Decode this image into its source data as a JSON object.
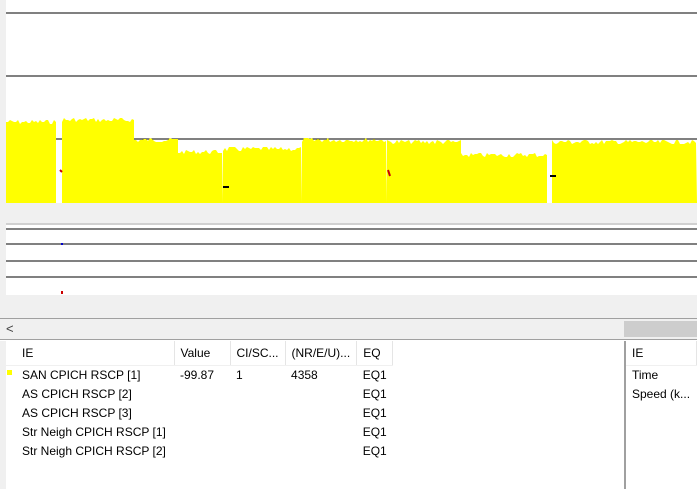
{
  "colors": {
    "signal_fill": "#ffff00",
    "panel_bg": "#ffffff",
    "frame": "#f0f0f0",
    "event_red": "#cc0000",
    "event_black": "#000000",
    "event_blue": "#0000cc"
  },
  "scrollbar": {
    "left_arrow": "<"
  },
  "ie_table": {
    "headers": [
      "IE",
      "Value",
      "CI/SC...",
      "(NR/E/U)...",
      "EQ"
    ],
    "rows": [
      {
        "ie": "SAN CPICH RSCP [1]",
        "value": "-99.87",
        "ci": "1",
        "nr": "4358",
        "eq": "EQ1",
        "marker_color": "#ffff00"
      },
      {
        "ie": "AS CPICH RSCP [2]",
        "value": "",
        "ci": "",
        "nr": "",
        "eq": "EQ1",
        "marker_color": ""
      },
      {
        "ie": "AS CPICH RSCP [3]",
        "value": "",
        "ci": "",
        "nr": "",
        "eq": "EQ1",
        "marker_color": ""
      },
      {
        "ie": "Str Neigh CPICH RSCP [1]",
        "value": "",
        "ci": "",
        "nr": "",
        "eq": "EQ1",
        "marker_color": ""
      },
      {
        "ie": "Str Neigh CPICH RSCP [2]",
        "value": "",
        "ci": "",
        "nr": "",
        "eq": "EQ1",
        "marker_color": ""
      }
    ]
  },
  "right_table": {
    "header": "IE",
    "rows": [
      "Time",
      "Speed (k..."
    ]
  }
}
